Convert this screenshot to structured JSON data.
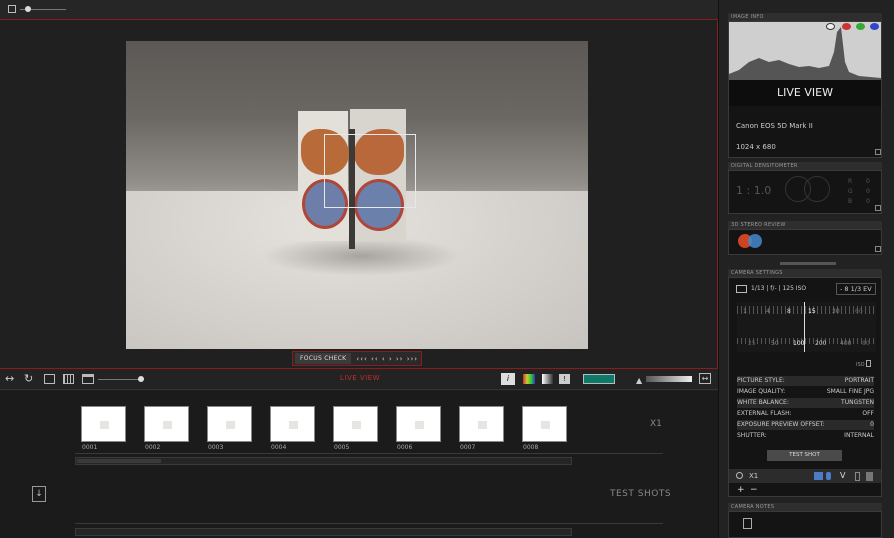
{
  "toolbar": {
    "live_view_label": "LIVE VIEW"
  },
  "viewer": {
    "focus_check_label": "FOCUS CHECK",
    "nav_arrows": "‹‹‹ ‹‹ ‹ › ›› ›››"
  },
  "filmstrip": {
    "thumbnails": [
      {
        "label": "0001"
      },
      {
        "label": "0002"
      },
      {
        "label": "0003"
      },
      {
        "label": "0004"
      },
      {
        "label": "0005"
      },
      {
        "label": "0006"
      },
      {
        "label": "0007"
      },
      {
        "label": "0008"
      }
    ],
    "zoom_label": "X1"
  },
  "test_shots": {
    "label": "TEST SHOTS"
  },
  "image_info": {
    "header": "IMAGE INFO",
    "title": "LIVE VIEW",
    "camera": "Canon EOS 5D Mark II",
    "resolution": "1024 x 680"
  },
  "densitometer": {
    "header": "DIGITAL DENSITOMETER",
    "ratio": "1 : 1.0",
    "r_label": "R",
    "g_label": "G",
    "b_label": "B",
    "r_value": "0",
    "g_value": "0",
    "b_value": "0"
  },
  "stereo": {
    "header": "3D STEREO REVIEW"
  },
  "camera_settings": {
    "header": "CAMERA SETTINGS",
    "readout": "1/13 | f/- | 125 ISO",
    "ev": "- 8 1/3 EV",
    "shutter_scale": [
      "1",
      "4",
      "8",
      "15",
      "30",
      "60"
    ],
    "iso_scale": [
      "25",
      "50",
      "100",
      "200",
      "400",
      "80"
    ],
    "iso_label": "ISO",
    "rows": [
      {
        "label": "PICTURE STYLE:",
        "value": "PORTRAIT"
      },
      {
        "label": "IMAGE QUALITY:",
        "value": "SMALL FINE JPG"
      },
      {
        "label": "WHITE BALANCE:",
        "value": "TUNGSTEN"
      },
      {
        "label": "EXTERNAL FLASH:",
        "value": "OFF"
      },
      {
        "label": "EXPOSURE PREVIEW OFFSET:",
        "value": "0"
      },
      {
        "label": "SHUTTER:",
        "value": "INTERNAL"
      }
    ],
    "test_shot_button": "TEST SHOT",
    "zoom_label": "X1"
  },
  "camera_notes": {
    "header": "CAMERA NOTES"
  },
  "colors": {
    "accent_red": "#8a1c1c",
    "live_view_red": "#c0302b"
  }
}
